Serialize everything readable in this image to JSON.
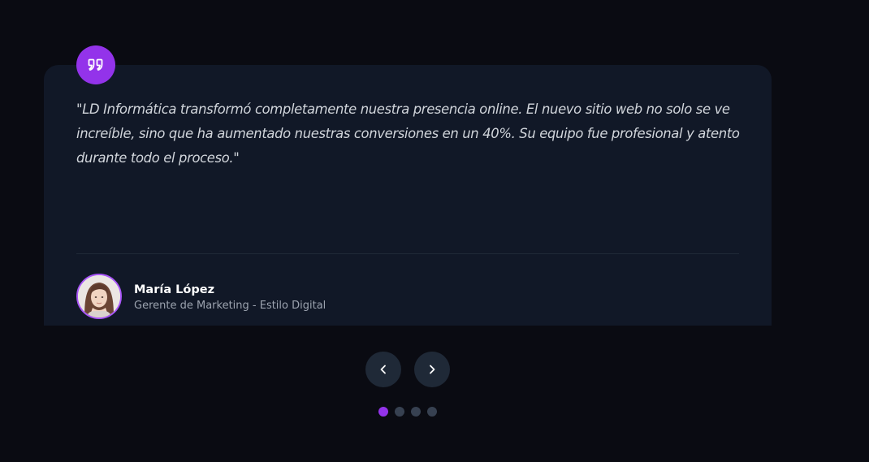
{
  "testimonial": {
    "quote": "\"LD Informática transformó completamente nuestra presencia online. El nuevo sitio web no solo se ve increíble, sino que ha aumentado nuestras conversiones en un 40%. Su equipo fue profesional y atento durante todo el proceso.\"",
    "author_name": "María López",
    "author_role": "Gerente de Marketing - Estilo Digital",
    "quote_icon": "quote-icon",
    "avatar_icon": "avatar-photo"
  },
  "navigation": {
    "prev_icon": "chevron-left-icon",
    "next_icon": "chevron-right-icon"
  },
  "pagination": {
    "total": 4,
    "active_index": 0
  },
  "colors": {
    "background": "#0a0b12",
    "card": "#111827",
    "accent": "#9333ea",
    "button": "#1f2937",
    "dot_inactive": "#374151"
  }
}
